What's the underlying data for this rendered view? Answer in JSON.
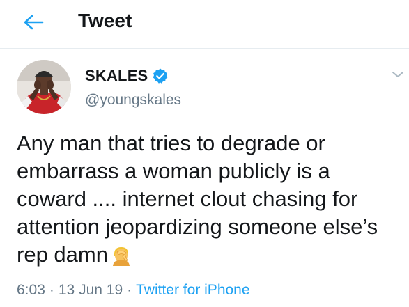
{
  "header": {
    "back_icon": "arrow-left-icon",
    "title": "Tweet"
  },
  "author": {
    "display_name": "SKALES",
    "handle": "@youngskales",
    "verified_icon": "verified-badge-icon",
    "avatar_icon": "avatar"
  },
  "menu": {
    "icon": "chevron-down-icon"
  },
  "tweet": {
    "text": "Any man that tries to degrade or\nembarrass a woman publicly is a\ncoward .... internet clout chasing for\nattention jeopardizing someone else’s\nrep damn",
    "emoji": "face-palm-emoji-icon"
  },
  "meta": {
    "time": "6:03",
    "date": "13 Jun 19",
    "separator": "·",
    "source": "Twitter for iPhone"
  },
  "colors": {
    "accent": "#1da1f2",
    "text": "#14171a",
    "secondary": "#657786",
    "divider": "#e6ecf0"
  }
}
